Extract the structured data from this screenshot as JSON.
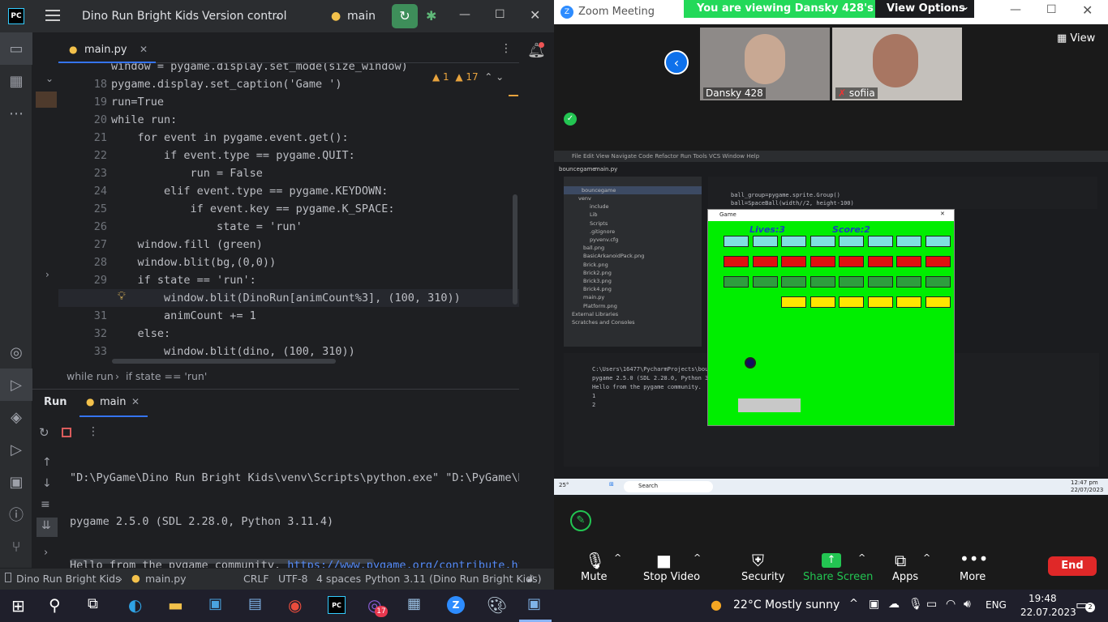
{
  "ide": {
    "project": "Dino Run Bright Kids",
    "vcs": "Version control",
    "branch": "main",
    "file_tab": "main.py",
    "inspection": {
      "warn1": "1",
      "warn2": "17"
    },
    "code": [
      {
        "n": "18",
        "t": "pygame.display.set_caption('Game ')"
      },
      {
        "n": "19",
        "t": "run=True"
      },
      {
        "n": "20",
        "t": "while run:"
      },
      {
        "n": "21",
        "t": "    for event in pygame.event.get():"
      },
      {
        "n": "22",
        "t": "        if event.type == pygame.QUIT:"
      },
      {
        "n": "23",
        "t": "            run = False"
      },
      {
        "n": "24",
        "t": "        elif event.type == pygame.KEYDOWN:"
      },
      {
        "n": "25",
        "t": "            if event.key == pygame.K_SPACE:"
      },
      {
        "n": "26",
        "t": "                state = 'run'"
      },
      {
        "n": "27",
        "t": "    window.fill (green)"
      },
      {
        "n": "28",
        "t": "    window.blit(bg,(0,0))"
      },
      {
        "n": "29",
        "t": "    if state == 'run':"
      },
      {
        "n": "30",
        "t": "        window.blit(DinoRun[animCount%3], (100, 310))"
      },
      {
        "n": "31",
        "t": "        animCount += 1"
      },
      {
        "n": "32",
        "t": "    else:"
      },
      {
        "n": "33",
        "t": "        window.blit(dino, (100, 310))"
      }
    ],
    "top_partial": "window = pygame.display.set_mode(size_window)",
    "breadcrumb": [
      "while run",
      "if state == 'run'"
    ],
    "run_tab": "Run",
    "run_config": "main",
    "output": [
      "\"D:\\PyGame\\Dino Run Bright Kids\\venv\\Scripts\\python.exe\" \"D:\\PyGame\\Di",
      "pygame 2.5.0 (SDL 2.28.0, Python 3.11.4)",
      "Hello from the pygame community. "
    ],
    "output_link": "https://www.pygame.org/contribute.htm",
    "status": {
      "project": "Dino Run Bright Kids",
      "file": "main.py",
      "line_sep": "CRLF",
      "encoding": "UTF-8",
      "indent": "4 spaces",
      "interpreter": "Python 3.11 (Dino Run Bright Kids)"
    }
  },
  "zoom": {
    "window_title": "Zoom Meeting",
    "banner": "You are viewing Dansky 428's screen",
    "view_options": "View Options",
    "view": "View",
    "participants": [
      "Dansky 428",
      "sofiia"
    ],
    "game_title": "Game",
    "lives": "Lives:3",
    "score": "Score:2",
    "toolbar": [
      "Mute",
      "Stop Video",
      "Security",
      "Share Screen",
      "Apps",
      "More"
    ],
    "end": "End",
    "remote": {
      "project": "bouncegame",
      "file": "main.py",
      "files": [
        "venv",
        "include",
        "Lib",
        "Scripts",
        ".gitignore",
        "pyvenv.cfg",
        "ball.png",
        "BasicArkanoidPack.png",
        "Brick.png",
        "Brick2.png",
        "Brick3.png",
        "Brick4.png",
        "main.py",
        "Platform.png",
        "External Libraries",
        "Scratches and Consoles"
      ],
      "code": [
        "ball_group=pygame.sprite.Group()",
        "ball=SpaceBall(width//2, height-100)"
      ],
      "output": [
        "C:\\Users\\16477\\PycharmProjects\\boun",
        "pygame 2.5.0 (SDL 2.28.0, Python 3.",
        "Hello from the pygame community.",
        "1",
        "2"
      ],
      "search": "Search",
      "clock": "12:47 pm",
      "date": "22/07/2023",
      "temp": "25°"
    }
  },
  "taskbar": {
    "weather": "22°C  Mostly sunny",
    "lang": "ENG",
    "time": "19:48",
    "date": "22.07.2023",
    "badge": "17",
    "notif": "2"
  },
  "colors": {
    "green": "#00ee00",
    "cyan": "#7fe0e0",
    "red": "#e01010",
    "dkgreen": "#2e9e3e",
    "yellow": "#ffe600"
  }
}
